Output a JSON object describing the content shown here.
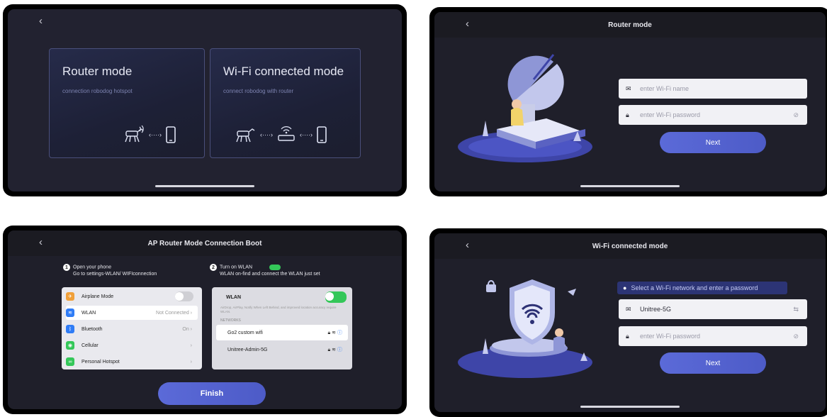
{
  "screen1": {
    "cards": [
      {
        "title": "Router mode",
        "subtitle": "connection robodog hotspot",
        "dots": "‹····›"
      },
      {
        "title": "Wi-Fi connected mode",
        "subtitle": "connect robodog with router",
        "dots": "‹····›"
      }
    ]
  },
  "screen2": {
    "title": "Router mode",
    "wifi_name_placeholder": "enter Wi-Fi name",
    "wifi_password_placeholder": "enter Wi-Fi password",
    "next_label": "Next"
  },
  "screen3": {
    "title": "AP Router Mode Connection Boot",
    "step1_num": "1",
    "step1_line1": "Open your phone",
    "step1_line2": "Go to settings-WLAN/ WIFIconnection",
    "step2_num": "2",
    "step2_line1": "Turn on WLAN",
    "step2_line2": "WLAN on-find and connect the WLAN just set",
    "settings": [
      {
        "label": "Airplane Mode",
        "right": "",
        "color": "#f0a03a"
      },
      {
        "label": "WLAN",
        "right": "Not Connected  ›",
        "color": "#2f7cf6"
      },
      {
        "label": "Bluetooth",
        "right": "On  ›",
        "color": "#2f7cf6"
      },
      {
        "label": "Cellular",
        "right": "›",
        "color": "#34c759"
      },
      {
        "label": "Personal Hotspot",
        "right": "›",
        "color": "#34c759"
      }
    ],
    "wlan_label": "WLAN",
    "wlan_note": "AirDrop, AirPlay, Notify When Left Behind, and improved location accuracy require WLAN.",
    "networks_header": "NETWORKS",
    "networks": [
      "Go2 custom wifi",
      "Unitree-Admin-5G"
    ],
    "finish_label": "Finish"
  },
  "screen4": {
    "title": "Wi-Fi connected mode",
    "notice": "Select a Wi-Fi network and enter a password",
    "wifi_value": "Unitree-5G",
    "wifi_password_placeholder": "enter Wi-Fi password",
    "next_label": "Next"
  },
  "colors": {
    "accent": "#5563d1",
    "toggle_on": "#34c759"
  }
}
